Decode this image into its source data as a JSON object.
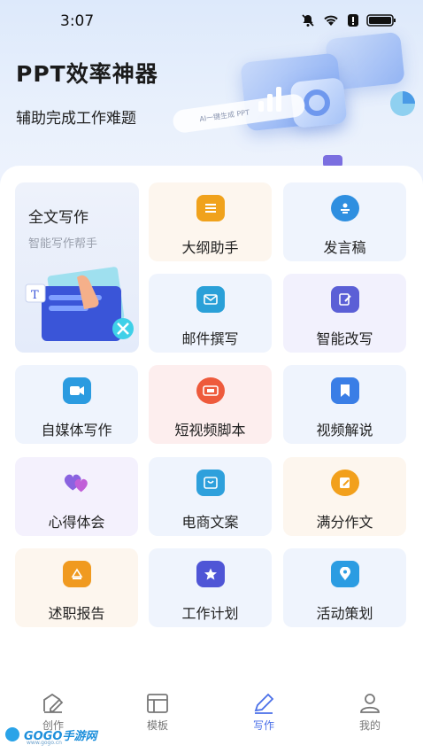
{
  "status_bar": {
    "time": "3:07"
  },
  "header": {
    "title": "PPT效率神器",
    "subtitle": "辅助完成工作难题",
    "chip_text": "AI一键生成 PPT"
  },
  "featured": {
    "title": "全文写作",
    "subtitle": "智能写作帮手",
    "doc_text": "T"
  },
  "tiles": [
    {
      "label": "大纲助手",
      "icon": "outline-icon",
      "color": "#f0a21c"
    },
    {
      "label": "发言稿",
      "icon": "speech-icon",
      "color": "#2f8fe0"
    },
    {
      "label": "邮件撰写",
      "icon": "mail-icon",
      "color": "#2aa0d8"
    },
    {
      "label": "智能改写",
      "icon": "edit-icon",
      "color": "#5b5fd6"
    },
    {
      "label": "自媒体写作",
      "icon": "camera-icon",
      "color": "#2b9be0"
    },
    {
      "label": "短视频脚本",
      "icon": "video-icon",
      "color": "#ee5a3c"
    },
    {
      "label": "视频解说",
      "icon": "bookmark-icon",
      "color": "#3a7ee6"
    },
    {
      "label": "心得体会",
      "icon": "hearts-icon",
      "color": "#8a63e0"
    },
    {
      "label": "电商文案",
      "icon": "shop-icon",
      "color": "#2ea0dc"
    },
    {
      "label": "满分作文",
      "icon": "write-icon",
      "color": "#f2a01c"
    },
    {
      "label": "述职报告",
      "icon": "report-icon",
      "color": "#f09a20"
    },
    {
      "label": "工作计划",
      "icon": "star-icon",
      "color": "#4f55d6"
    },
    {
      "label": "活动策划",
      "icon": "location-icon",
      "color": "#2b9ce2"
    }
  ],
  "nav": {
    "items": [
      {
        "label": "创作",
        "icon": "create-icon"
      },
      {
        "label": "模板",
        "icon": "template-icon"
      },
      {
        "label": "写作",
        "icon": "pen-icon"
      },
      {
        "label": "我的",
        "icon": "user-icon"
      }
    ],
    "active_color": "#4a6fe8"
  },
  "watermark": {
    "text": "GOGO手游网",
    "url": "www.gogo.cn"
  }
}
